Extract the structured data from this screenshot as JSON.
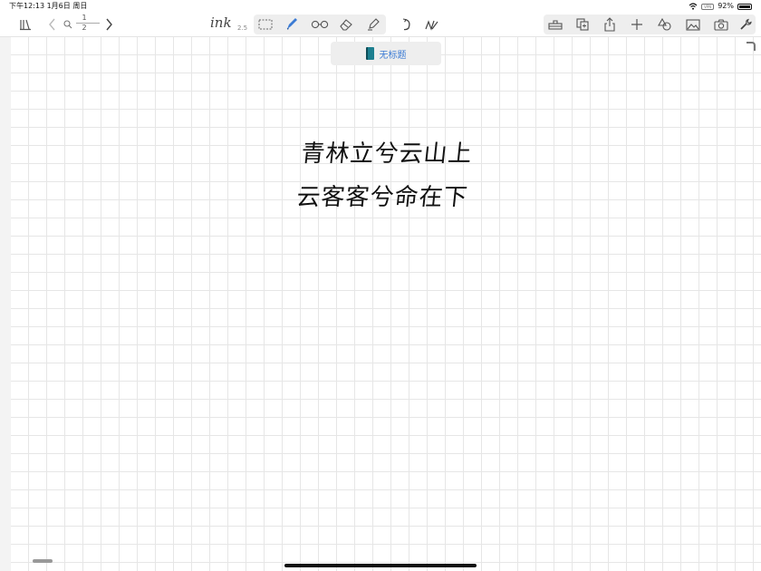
{
  "status_bar": {
    "time_date": "下午12:13  1月6日 周日",
    "battery": "92%",
    "vpn": "VPN"
  },
  "toolbar": {
    "page_current": "1",
    "page_total": "2",
    "ink_label": "ink",
    "pen_size": "2.5"
  },
  "document": {
    "title": "无标题",
    "handwriting_line1": "青林立兮云山上",
    "handwriting_line2": "云客客兮命在下"
  },
  "colors": {
    "accent": "#3b7bd4",
    "notebook_cover": "#1d7f8f"
  }
}
